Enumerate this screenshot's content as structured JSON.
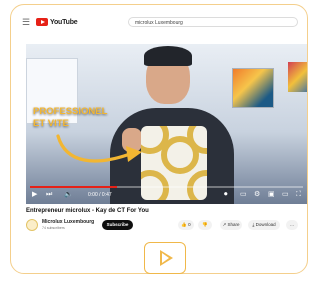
{
  "app": {
    "name": "YouTube",
    "superscript": "FR"
  },
  "search": {
    "query": "microlux Luxembourg"
  },
  "video": {
    "overlay_caption": "PROFESSIONEL ET VITE",
    "progress_fraction": 0.32,
    "time_label": "0:00 / 0:47"
  },
  "title": "Entrepreneur microlux - Kay de CT For You",
  "channel": {
    "name": "Microlux Luxembourg",
    "subscribers": "74 subscribers"
  },
  "actions": {
    "subscribe": "Subscribe",
    "like": "0",
    "share": "Share",
    "download": "Download",
    "more": "…"
  },
  "colors": {
    "accent": "#e62117",
    "brand_gold": "#f0b84a"
  }
}
